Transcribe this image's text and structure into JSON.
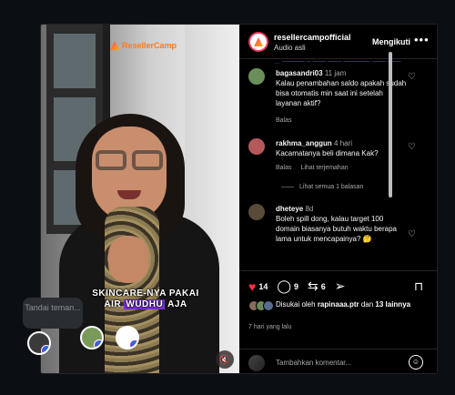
{
  "video": {
    "brand": "ResellerCamp",
    "caption_line1": "SKINCARE-NYA PAKAI",
    "caption_pre": "AIR ",
    "caption_highlight": "WUDHU",
    "caption_post": " AJA",
    "mute_icon": "speaker-muted-icon"
  },
  "tag_tooltip": "Tandai teman...",
  "header": {
    "username": "resellercampofficial",
    "audio": "Audio asli",
    "follow": "Mengikuti",
    "more": "•••"
  },
  "comments": [
    {
      "user": "bagasandri03",
      "time": "11 jam",
      "text": "Kalau penambahan saldo apakah sudah bisa otomatis min saat ini setelah layanan aktif?",
      "reply": "Balas",
      "avatar_color": "#6b8f5a"
    },
    {
      "user": "rakhma_anggun",
      "time": "4 hari",
      "text": "Kacamatanya beli dimana Kak?",
      "reply": "Balas",
      "translate": "Lihat terjemahan",
      "see_replies": "Lihat semua 1 balasan",
      "avatar_color": "#b5585a"
    },
    {
      "user": "dheteye",
      "time": "8d",
      "text": "Boleh spill dong, kalau target 100 domain biasanya butuh waktu berapa lama untuk mencapainya? 🤔",
      "avatar_color": "#5a4a3a"
    }
  ],
  "actions": {
    "likes": "14",
    "comments": "9",
    "shares": "6"
  },
  "liked_by": {
    "prefix": "Disukai oleh ",
    "user": "rapinaaa.ptr",
    "middle": " dan ",
    "others": "13 lainnya"
  },
  "posted": "7 hari yang lalu",
  "add_comment": {
    "placeholder": "Tambahkan komentar..."
  },
  "colors": {
    "like": "#ff3040",
    "brand_gradient_start": "#ff3d6e",
    "brand_gradient_end": "#ffb300",
    "highlight": "#7a2fd6"
  }
}
